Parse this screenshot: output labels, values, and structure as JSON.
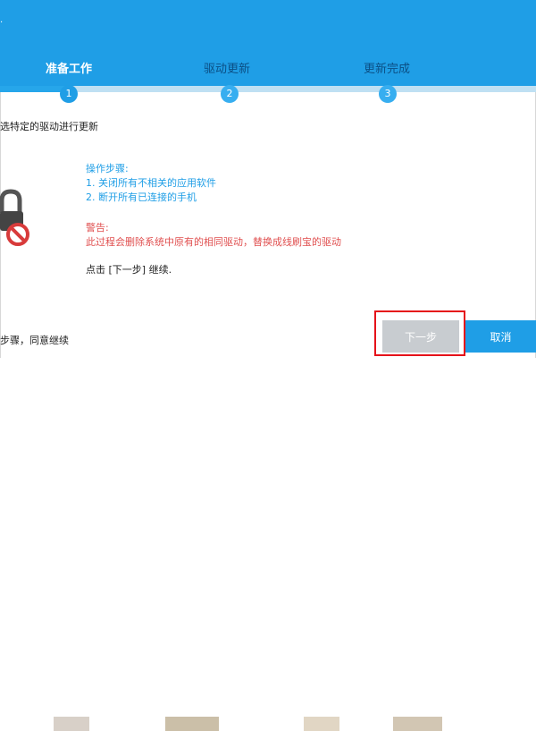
{
  "header": {
    "glyph": "·",
    "steps": [
      {
        "label": "准备工作",
        "number": "1",
        "state": "active"
      },
      {
        "label": "驱动更新",
        "number": "2",
        "state": "inactive"
      },
      {
        "label": "更新完成",
        "number": "3",
        "state": "inactive"
      }
    ]
  },
  "main": {
    "intro": "选特定的驱动进行更新",
    "steps_title": "操作步骤:",
    "step1": "1. 关闭所有不相关的应用软件",
    "step2": "2. 断开所有已连接的手机",
    "warning_title": "警告:",
    "warning_text": "此过程会删除系统中原有的相同驱动，替换成线刷宝的驱动",
    "continue_text": "点击 [下一步] 继续."
  },
  "footer": {
    "agree_text": "步骤，同意继续",
    "next_label": "下一步",
    "cancel_label": "取消"
  },
  "colors": {
    "header_blue": "#1f9ee6",
    "warning_red": "#e05050",
    "disabled_gray": "#c8ccd0",
    "highlight_red": "#e5121a"
  },
  "icons": [
    "lock-icon",
    "prohibited-icon"
  ]
}
